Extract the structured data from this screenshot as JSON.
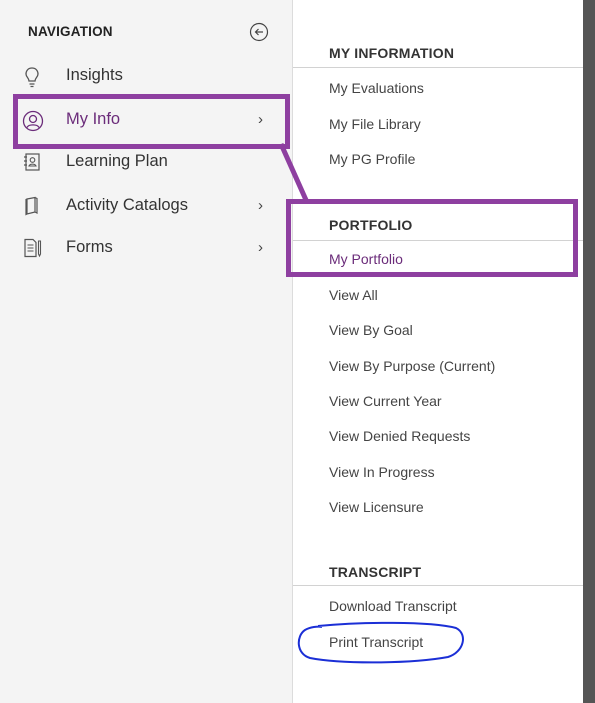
{
  "navigation": {
    "header": "NAVIGATION",
    "collapse_icon": "circle-arrow-left-icon",
    "items": [
      {
        "label": "Insights",
        "icon": "lightbulb-icon",
        "has_submenu": false
      },
      {
        "label": "My Info",
        "icon": "user-circle-icon",
        "has_submenu": true,
        "active": true
      },
      {
        "label": "Learning Plan",
        "icon": "address-book-icon",
        "has_submenu": false
      },
      {
        "label": "Activity Catalogs",
        "icon": "book-icon",
        "has_submenu": true
      },
      {
        "label": "Forms",
        "icon": "document-form-icon",
        "has_submenu": true
      }
    ],
    "chevron": "›"
  },
  "submenu": {
    "sections": [
      {
        "title": "MY INFORMATION",
        "items": [
          "My Evaluations",
          "My File Library",
          "My PG Profile"
        ]
      },
      {
        "title": "PORTFOLIO",
        "items": [
          "My Portfolio",
          "View All",
          "View By Goal",
          "View By Purpose (Current)",
          "View Current Year",
          "View Denied Requests",
          "View In Progress",
          "View Licensure"
        ],
        "active_item": "My Portfolio"
      },
      {
        "title": "TRANSCRIPT",
        "items": [
          "Download Transcript",
          "Print Transcript"
        ]
      }
    ]
  },
  "colors": {
    "accent": "#6b2c7a",
    "highlight_box": "#8e3fa0",
    "annotation_circle": "#1b2fd6",
    "nav_bg": "#f4f4f4"
  }
}
